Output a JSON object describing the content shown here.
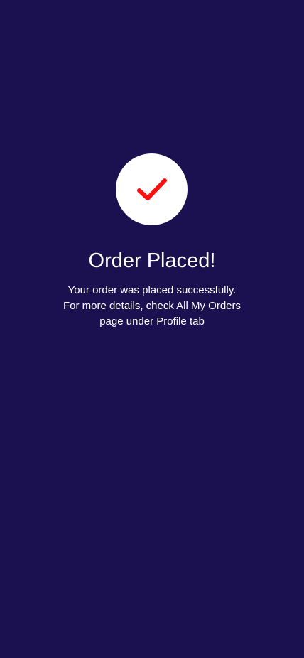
{
  "colors": {
    "background": "#1c1150",
    "badge_background": "#ffffff",
    "check": "#ff1010",
    "text": "#ffffff"
  },
  "status": {
    "icon": "checkmark-icon",
    "title": "Order Placed!",
    "message_lines": [
      "Your order was placed successfully.",
      "For more details, check All My Orders",
      "page under Profile tab"
    ]
  }
}
